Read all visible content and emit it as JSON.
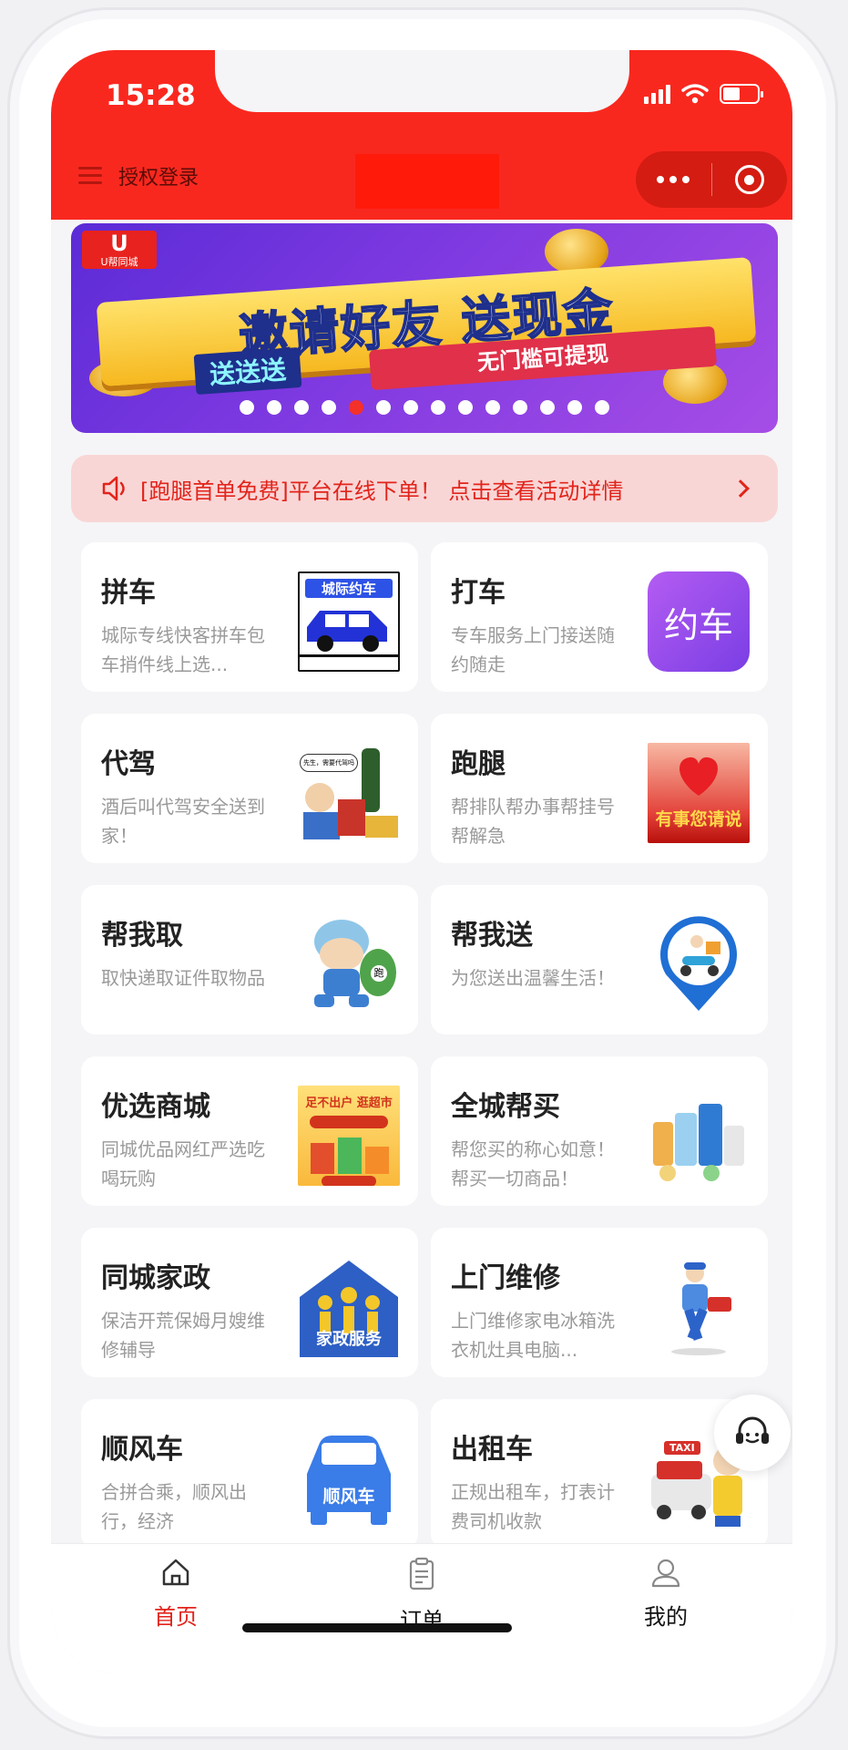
{
  "status_bar": {
    "time": "15:28"
  },
  "nav": {
    "login_label": "授权登录"
  },
  "banner": {
    "logo_main": "U",
    "logo_sub": "U帮同城",
    "headline": "邀请好友  送现金",
    "tag_left": "送送送",
    "tag_right": "无门槛可提现",
    "slide_count": 14,
    "active_slide": 4
  },
  "notice": {
    "text": "[跑腿首单免费]平台在线下单！ 点击查看活动详情"
  },
  "services": [
    {
      "title": "拼车",
      "desc": "城际专线快客拼车包车捎件线上选...",
      "icon": "intercity-car-icon",
      "img_text": "城际约车"
    },
    {
      "title": "打车",
      "desc": "专车服务上门接送随约随走",
      "icon": "ride-hail-app-icon",
      "img_text": "约车"
    },
    {
      "title": "代驾",
      "desc": "酒后叫代驾安全送到家！",
      "icon": "designated-driver-icon",
      "img_text": "先生，需要代驾吗"
    },
    {
      "title": "跑腿",
      "desc": "帮排队帮办事帮挂号帮解急",
      "icon": "errand-heart-icon",
      "img_text": "有事您请说"
    },
    {
      "title": "帮我取",
      "desc": "取快递取证件取物品",
      "icon": "courier-runner-icon",
      "img_text": "跑"
    },
    {
      "title": "帮我送",
      "desc": "为您送出温馨生活！",
      "icon": "delivery-pin-icon",
      "img_text": ""
    },
    {
      "title": "优选商城",
      "desc": "同城优品网红严选吃喝玩购",
      "icon": "supermarket-icon",
      "img_text": "足不出户 逛超市"
    },
    {
      "title": "全城帮买",
      "desc": "帮您买的称心如意！帮买一切商品！",
      "icon": "groceries-icon",
      "img_text": ""
    },
    {
      "title": "同城家政",
      "desc": "保洁开荒保姆月嫂维修辅导",
      "icon": "housekeeping-icon",
      "img_text": "家政服务"
    },
    {
      "title": "上门维修",
      "desc": "上门维修家电冰箱洗衣机灶具电脑...",
      "icon": "repairman-icon",
      "img_text": ""
    },
    {
      "title": "顺风车",
      "desc": "合拼合乘，顺风出行，经济",
      "icon": "carpool-car-icon",
      "img_text": "顺风车"
    },
    {
      "title": "出租车",
      "desc": "正规出租车，打表计费司机收款",
      "icon": "taxi-icon",
      "img_text": "TAXI"
    }
  ],
  "tabbar": {
    "home": "首页",
    "orders": "订单",
    "mine": "我的"
  },
  "colors": {
    "brand_red": "#f9281f",
    "active_tab": "#e2241b",
    "notice_bg": "#f9d6d6"
  }
}
